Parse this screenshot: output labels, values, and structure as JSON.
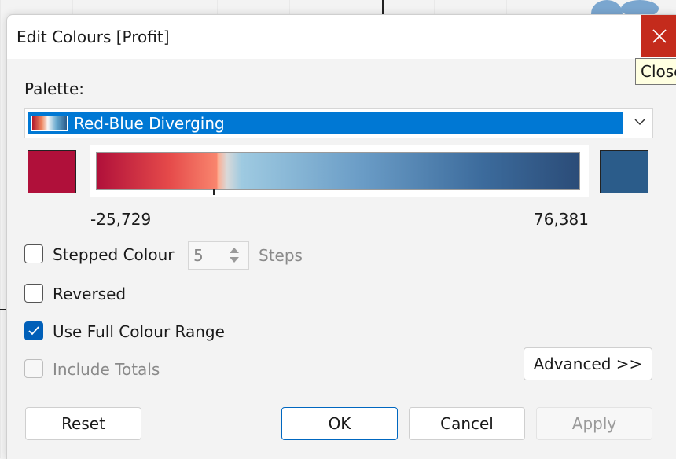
{
  "window": {
    "title": "Edit Colours [Profit]",
    "close_tooltip": "Close"
  },
  "palette": {
    "label": "Palette:",
    "selected": "Red-Blue Diverging"
  },
  "range": {
    "min": "-25,729",
    "max": "76,381",
    "start_color": "#b0103a",
    "end_color": "#2b5c8a"
  },
  "options": {
    "stepped_colour": {
      "label": "Stepped Colour",
      "checked": false,
      "steps_value": "5",
      "steps_label": "Steps"
    },
    "reversed": {
      "label": "Reversed",
      "checked": false
    },
    "use_full_range": {
      "label": "Use Full Colour Range",
      "checked": true
    },
    "include_totals": {
      "label": "Include Totals",
      "checked": false,
      "disabled": true
    }
  },
  "buttons": {
    "advanced": "Advanced >>",
    "reset": "Reset",
    "ok": "OK",
    "cancel": "Cancel",
    "apply": "Apply"
  },
  "colors": {
    "accent": "#0078d4",
    "close": "#c42b1c"
  }
}
